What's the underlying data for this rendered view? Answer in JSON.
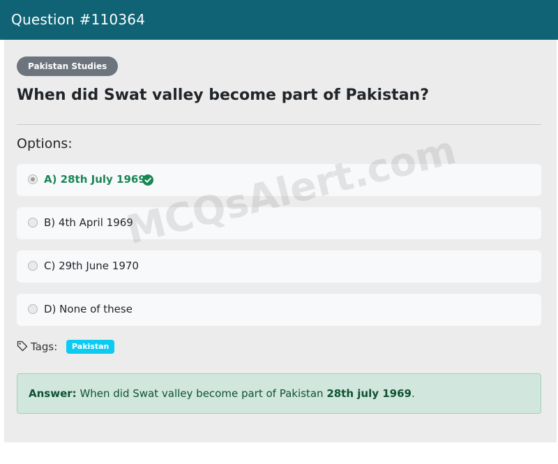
{
  "header": {
    "title": "Question #110364"
  },
  "question": {
    "category": "Pakistan Studies",
    "text": "When did Swat valley become part of Pakistan?",
    "options_label": "Options:",
    "options": [
      {
        "label": "A) 28th July 1969",
        "selected": true,
        "correct": true
      },
      {
        "label": "B) 4th April 1969",
        "selected": false,
        "correct": false
      },
      {
        "label": "C) 29th June 1970",
        "selected": false,
        "correct": false
      },
      {
        "label": "D) None of these",
        "selected": false,
        "correct": false
      }
    ]
  },
  "tags": {
    "label": "Tags:",
    "items": [
      "Pakistan"
    ]
  },
  "answer": {
    "prefix": "Answer:",
    "text": "When did Swat valley become part of Pakistan",
    "value": "28th july 1969",
    "suffix": "."
  },
  "watermark": "MCQsAlert.com",
  "colors": {
    "header": "#0f6375",
    "correct": "#198754",
    "tag": "#0dcaf0",
    "answer_bg": "#d1e7dd"
  },
  "icons": {
    "check": "check-circle-icon",
    "tag": "tag-icon"
  }
}
